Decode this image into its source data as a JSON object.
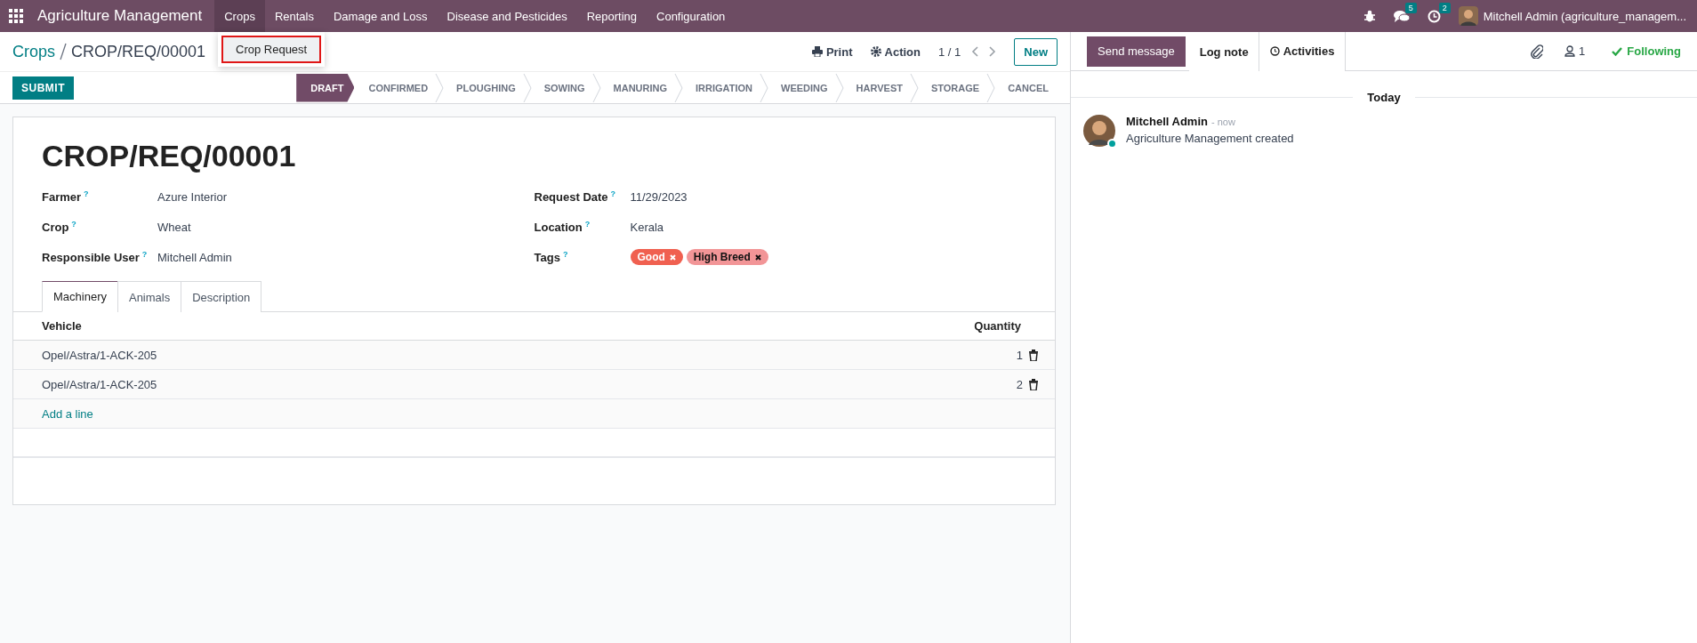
{
  "navbar": {
    "app_name": "Agriculture Management",
    "menus": [
      {
        "label": "Crops",
        "expanded": true
      },
      {
        "label": "Rentals",
        "expanded": false
      },
      {
        "label": "Damage and Loss",
        "expanded": false
      },
      {
        "label": "Disease and Pesticides",
        "expanded": false
      },
      {
        "label": "Reporting",
        "expanded": false
      },
      {
        "label": "Configuration",
        "expanded": false
      }
    ],
    "message_count": "5",
    "activity_count": "2",
    "user": "Mitchell Admin (agriculture_managem..."
  },
  "dropdown": {
    "items": [
      {
        "label": "Crop Request",
        "highlighted": true
      }
    ]
  },
  "breadcrumb": {
    "parent": "Crops",
    "current": "CROP/REQ/00001"
  },
  "actions": {
    "print": "Print",
    "action": "Action",
    "pager": "1 / 1",
    "new": "New"
  },
  "submit": "SUBMIT",
  "stages": [
    {
      "label": "DRAFT",
      "selected": true
    },
    {
      "label": "CONFIRMED",
      "selected": false
    },
    {
      "label": "PLOUGHING",
      "selected": false
    },
    {
      "label": "SOWING",
      "selected": false
    },
    {
      "label": "MANURING",
      "selected": false
    },
    {
      "label": "IRRIGATION",
      "selected": false
    },
    {
      "label": "WEEDING",
      "selected": false
    },
    {
      "label": "HARVEST",
      "selected": false
    },
    {
      "label": "STORAGE",
      "selected": false
    },
    {
      "label": "CANCEL",
      "selected": false
    }
  ],
  "form": {
    "title": "CROP/REQ/00001",
    "left_fields": [
      {
        "label": "Farmer",
        "help": "?",
        "value": "Azure Interior"
      },
      {
        "label": "Crop",
        "help": "?",
        "value": "Wheat"
      },
      {
        "label": "Responsible User",
        "help": "?",
        "value": "Mitchell Admin"
      }
    ],
    "right_fields": [
      {
        "label": "Request Date",
        "help": "?",
        "value": "11/29/2023"
      },
      {
        "label": "Location",
        "help": "?",
        "value": "Kerala"
      },
      {
        "label": "Tags",
        "help": "?",
        "tags": [
          {
            "label": "Good",
            "color": "#f06050"
          },
          {
            "label": "High Breed",
            "color": "#f29597"
          }
        ]
      }
    ],
    "tabs": [
      {
        "label": "Machinery",
        "selected": true
      },
      {
        "label": "Animals",
        "selected": false
      },
      {
        "label": "Description",
        "selected": false
      }
    ],
    "table": {
      "columns": [
        "Vehicle",
        "Quantity"
      ],
      "rows": [
        {
          "vehicle": "Opel/Astra/1-ACK-205",
          "quantity": "1"
        },
        {
          "vehicle": "Opel/Astra/1-ACK-205",
          "quantity": "2"
        }
      ],
      "add_line": "Add a line"
    }
  },
  "chatter": {
    "buttons": [
      {
        "label": "Send message",
        "kind": "primary"
      },
      {
        "label": "Log note",
        "kind": "tab"
      },
      {
        "label": "Activities",
        "kind": "tab-icon"
      }
    ],
    "followers": "1",
    "following": "Following",
    "day": "Today",
    "messages": [
      {
        "author": "Mitchell Admin",
        "time": "- now",
        "body": "Agriculture Management created"
      }
    ]
  }
}
